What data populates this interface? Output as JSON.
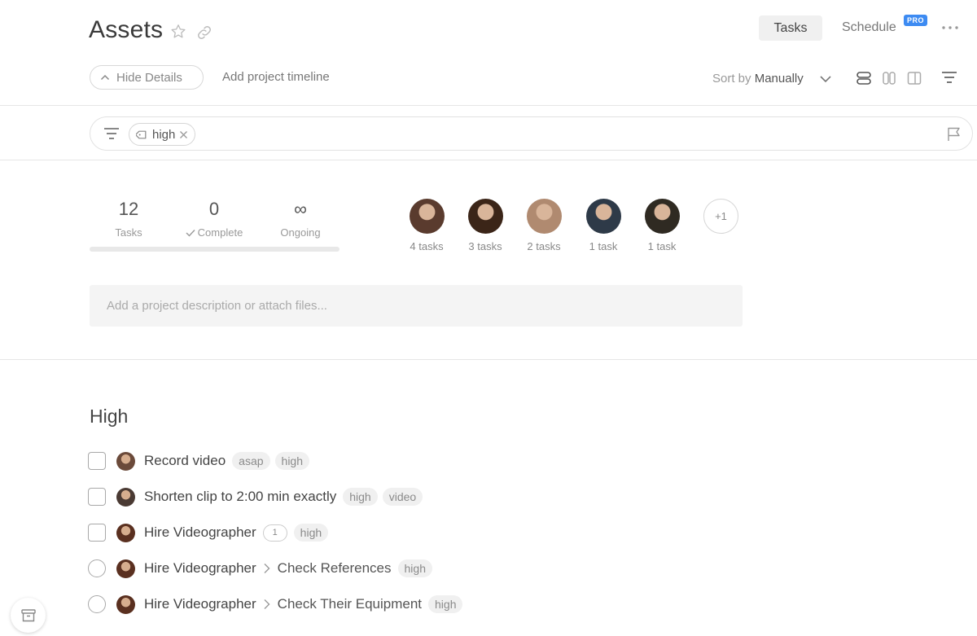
{
  "header": {
    "title": "Assets",
    "tabs": [
      {
        "label": "Tasks",
        "active": true
      },
      {
        "label": "Schedule",
        "badge": "PRO"
      }
    ]
  },
  "toolbar": {
    "hide_details": "Hide Details",
    "add_timeline": "Add project timeline",
    "sort_prefix": "Sort by",
    "sort_value": "Manually"
  },
  "filter": {
    "chips": [
      {
        "label": "high"
      }
    ]
  },
  "stats": [
    {
      "value": "12",
      "label": "Tasks"
    },
    {
      "value": "0",
      "label": "Complete"
    },
    {
      "value": "∞",
      "label": "Ongoing"
    }
  ],
  "progress": 0,
  "members": [
    {
      "count": "4 tasks",
      "color": "#5a3b2e"
    },
    {
      "count": "3 tasks",
      "color": "#3b2518"
    },
    {
      "count": "2 tasks",
      "color": "#b08a70"
    },
    {
      "count": "1 task",
      "color": "#2e3a48"
    },
    {
      "count": "1 task",
      "color": "#2f2a22"
    }
  ],
  "more_members": "+1",
  "description_placeholder": "Add a project description or attach files...",
  "section": {
    "title": "High",
    "tasks": [
      {
        "name": "Record video",
        "tags": [
          "asap",
          "high"
        ],
        "shape": "square",
        "avatar_color": "#6b4a3a"
      },
      {
        "name": "Shorten clip to 2:00 min exactly",
        "tags": [
          "high",
          "video"
        ],
        "shape": "square",
        "avatar_color": "#4a3a33"
      },
      {
        "name": "Hire Videographer",
        "comments": "1",
        "tags": [
          "high"
        ],
        "shape": "square",
        "avatar_color": "#5a3020"
      },
      {
        "name": "Hire Videographer",
        "subtask": "Check References",
        "tags": [
          "high"
        ],
        "shape": "round",
        "avatar_color": "#5a3020"
      },
      {
        "name": "Hire Videographer",
        "subtask": "Check Their Equipment",
        "tags": [
          "high"
        ],
        "shape": "round",
        "avatar_color": "#5a3020"
      }
    ]
  }
}
